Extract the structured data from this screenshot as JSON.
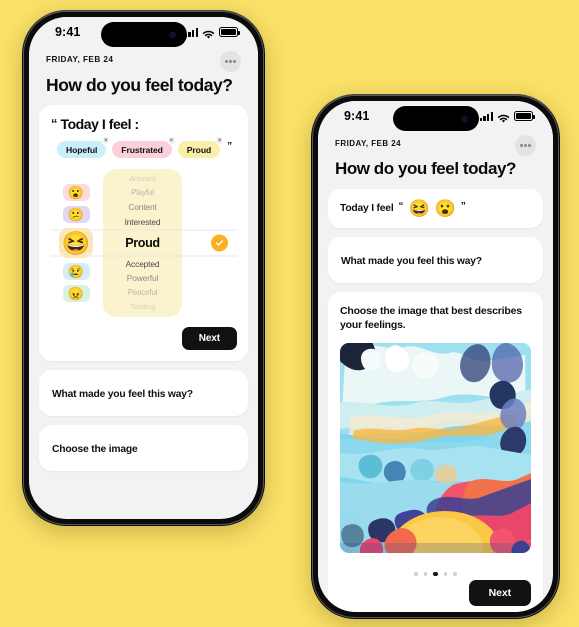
{
  "background_color": "#FAE167",
  "status_bar": {
    "time": "9:41",
    "icons": [
      "cellular-signal-icon",
      "wifi-icon",
      "battery-icon"
    ]
  },
  "phone_left": {
    "header": {
      "date": "FRIDAY, FEB 24",
      "title": "How do you feel today?",
      "more_button": "more-options-button"
    },
    "composer": {
      "open_quote": "“",
      "close_quote": "”",
      "prompt": "Today I feel :",
      "tags": [
        {
          "label": "Hopeful",
          "color": "#CBEEFB",
          "remove": "×"
        },
        {
          "label": "Frustrated",
          "color": "#FBD0DA",
          "remove": "×"
        },
        {
          "label": "Proud",
          "color": "#FBEFA8",
          "remove": "×"
        }
      ],
      "emoji_chips": [
        {
          "emoji": "😮",
          "color": "#FADCE0",
          "selected": false
        },
        {
          "emoji": "😕",
          "color": "#E0D7F2",
          "selected": false
        },
        {
          "emoji": "😆",
          "color": "#FBE7B8",
          "selected": true
        },
        {
          "emoji": "😢",
          "color": "#D3EEF7",
          "selected": false
        },
        {
          "emoji": "😠",
          "color": "#D6F2E2",
          "selected": false
        }
      ],
      "wheel": {
        "panel_color": "#FBF3CE",
        "selected": "Proud",
        "items": [
          {
            "label": "Aroused",
            "fade": "f0"
          },
          {
            "label": "Playful",
            "fade": "f1"
          },
          {
            "label": "Content",
            "fade": "f2"
          },
          {
            "label": "Interested",
            "fade": "f3"
          },
          {
            "label": "Proud",
            "fade": "sel"
          },
          {
            "label": "Accepted",
            "fade": "f3"
          },
          {
            "label": "Powerful",
            "fade": "f2"
          },
          {
            "label": "Peaceful",
            "fade": "f1"
          },
          {
            "label": "Trusting",
            "fade": "f0"
          }
        ],
        "confirm_icon": "checkmark-icon",
        "confirm_color": "#FBB024"
      },
      "next_label": "Next"
    },
    "collapsed_cards": [
      {
        "label": "What made you feel this way?"
      },
      {
        "label": "Choose the image"
      }
    ]
  },
  "phone_right": {
    "header": {
      "date": "FRIDAY, FEB 24",
      "title": "How do you feel today?",
      "more_button": "more-options-button"
    },
    "feel_card": {
      "label": "Today I feel",
      "open_quote": "“",
      "close_quote": "”",
      "emojis": [
        "😆",
        "😮"
      ]
    },
    "reason_card": {
      "label": "What made you feel this way?"
    },
    "image_card": {
      "label": "Choose the image that best describes your feelings.",
      "artwork_name": "abstract-painting-thumbnail",
      "carousel": {
        "total": 5,
        "active_index": 2
      },
      "next_label": "Next"
    }
  }
}
